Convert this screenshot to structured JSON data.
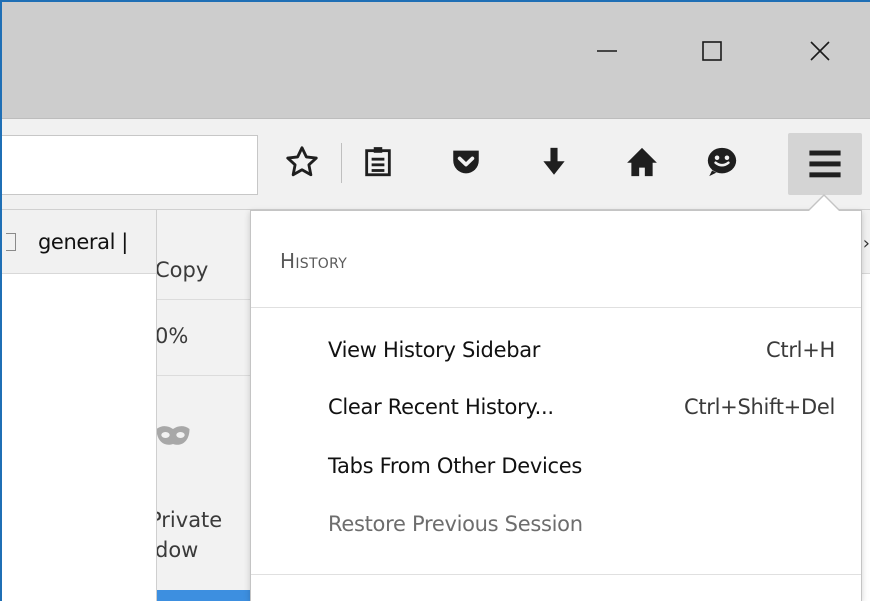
{
  "window_controls": {
    "minimize_glyph": "—",
    "maximize_glyph": "☐",
    "close_glyph": "✕"
  },
  "toolbar": {
    "icons": [
      "bookmark-star-icon",
      "reading-list-icon",
      "pocket-icon",
      "download-icon",
      "home-icon",
      "hello-chat-icon",
      "hamburger-menu-icon"
    ]
  },
  "bookmarks_bar": {
    "item_label": "general |",
    "overflow_glyph": "›"
  },
  "behind_panel": {
    "copy_label": "Copy",
    "zoom_label": "0%",
    "private_label_1": "Private",
    "private_label_2": "dow"
  },
  "history_panel": {
    "title": "History",
    "items": [
      {
        "label": "View History Sidebar",
        "accel": "Ctrl+H",
        "enabled": true
      },
      {
        "label": "Clear Recent History...",
        "accel": "Ctrl+Shift+Del",
        "enabled": true
      },
      {
        "label": "Tabs From Other Devices",
        "accel": "",
        "enabled": true
      },
      {
        "label": "Restore Previous Session",
        "accel": "",
        "enabled": false
      }
    ]
  },
  "colors": {
    "titlebar": "#cdcdcd",
    "toolbar": "#f1f1f1",
    "menu_button_active": "#d4d4d4",
    "accent": "#3d8fe0"
  }
}
